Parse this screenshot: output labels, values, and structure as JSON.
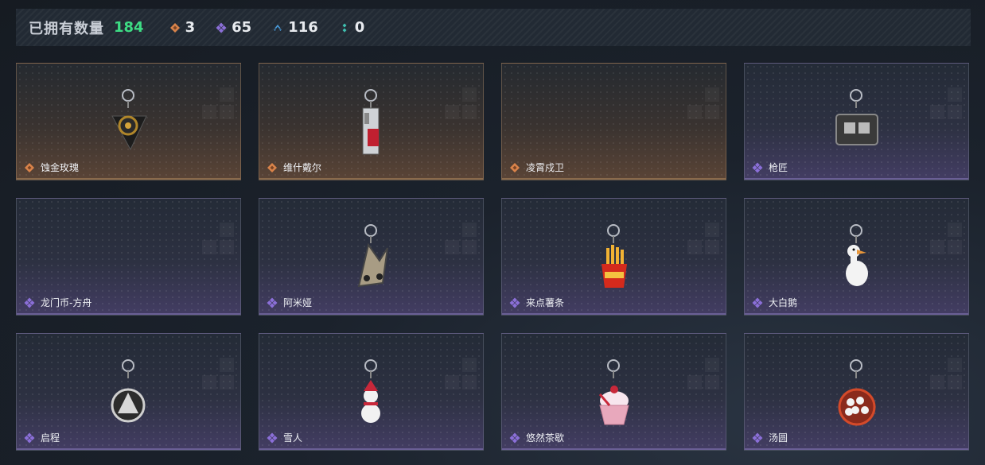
{
  "header": {
    "owned_label": "已拥有数量",
    "owned_count": "184",
    "stats": [
      {
        "icon": "orange-diamond-icon",
        "color": "#d9834a",
        "value": "3"
      },
      {
        "icon": "purple-diamond-icon",
        "color": "#8b6fd8",
        "value": "65"
      },
      {
        "icon": "blue-chevron-icon",
        "color": "#4a9ee0",
        "value": "116"
      },
      {
        "icon": "teal-dots-icon",
        "color": "#3fc0b0",
        "value": "0"
      }
    ]
  },
  "items": [
    {
      "name": "蚀金玫瑰",
      "rarity": "orange",
      "art": "rose-keychain-icon"
    },
    {
      "name": "维什戴尔",
      "rarity": "orange",
      "art": "card-keychain-icon"
    },
    {
      "name": "凌霄戍卫",
      "rarity": "orange",
      "art": ""
    },
    {
      "name": "枪匠",
      "rarity": "purple",
      "art": "case-keychain-icon"
    },
    {
      "name": "龙门币-方舟",
      "rarity": "purple",
      "art": ""
    },
    {
      "name": "阿米娅",
      "rarity": "purple",
      "art": "ears-keychain-icon"
    },
    {
      "name": "来点薯条",
      "rarity": "purple",
      "art": "fries-keychain-icon"
    },
    {
      "name": "大白鹅",
      "rarity": "purple",
      "art": "goose-keychain-icon"
    },
    {
      "name": "启程",
      "rarity": "purple",
      "art": "medal-keychain-icon"
    },
    {
      "name": "雪人",
      "rarity": "purple",
      "art": "snowman-keychain-icon"
    },
    {
      "name": "悠然茶歇",
      "rarity": "purple",
      "art": "cupcake-keychain-icon"
    },
    {
      "name": "汤圆",
      "rarity": "purple",
      "art": "bowl-keychain-icon"
    }
  ]
}
